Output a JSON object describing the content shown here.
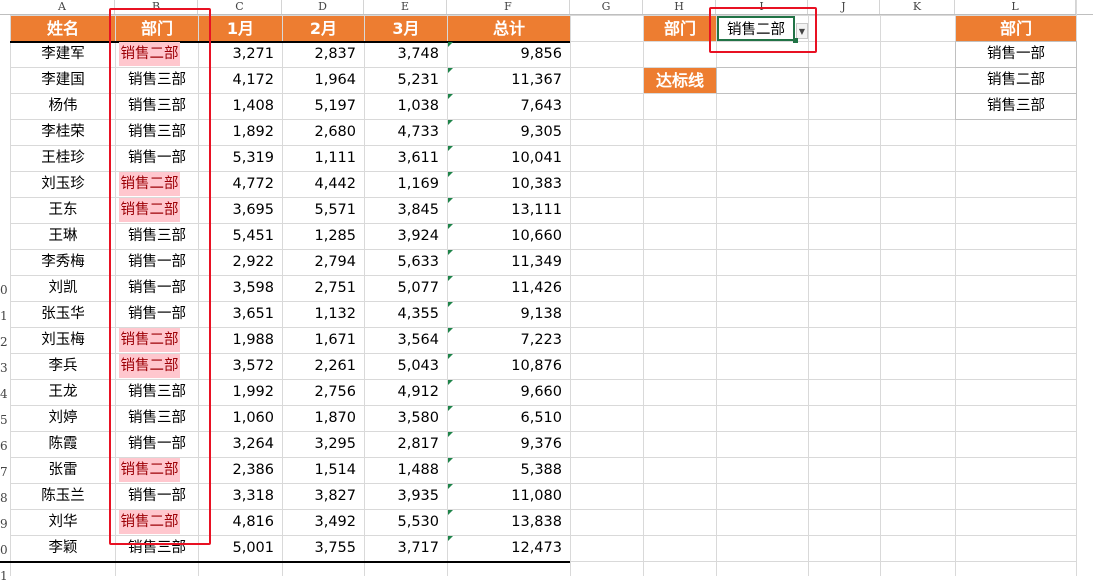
{
  "columns": [
    "A",
    "B",
    "C",
    "D",
    "E",
    "F",
    "G",
    "H",
    "I",
    "J",
    "K",
    "L"
  ],
  "row_labels": [
    "0",
    "1",
    "2",
    "3",
    "4",
    "5",
    "6",
    "7",
    "8",
    "9",
    "0",
    "1"
  ],
  "table": {
    "headers": [
      "姓名",
      "部门",
      "1月",
      "2月",
      "3月",
      "总计"
    ],
    "rows": [
      [
        "李建军",
        "销售二部",
        "3,271",
        "2,837",
        "3,748",
        "9,856"
      ],
      [
        "李建国",
        "销售三部",
        "4,172",
        "1,964",
        "5,231",
        "11,367"
      ],
      [
        "杨伟",
        "销售三部",
        "1,408",
        "5,197",
        "1,038",
        "7,643"
      ],
      [
        "李桂荣",
        "销售三部",
        "1,892",
        "2,680",
        "4,733",
        "9,305"
      ],
      [
        "王桂珍",
        "销售一部",
        "5,319",
        "1,111",
        "3,611",
        "10,041"
      ],
      [
        "刘玉珍",
        "销售二部",
        "4,772",
        "4,442",
        "1,169",
        "10,383"
      ],
      [
        "王东",
        "销售二部",
        "3,695",
        "5,571",
        "3,845",
        "13,111"
      ],
      [
        "王琳",
        "销售三部",
        "5,451",
        "1,285",
        "3,924",
        "10,660"
      ],
      [
        "李秀梅",
        "销售一部",
        "2,922",
        "2,794",
        "5,633",
        "11,349"
      ],
      [
        "刘凯",
        "销售一部",
        "3,598",
        "2,751",
        "5,077",
        "11,426"
      ],
      [
        "张玉华",
        "销售一部",
        "3,651",
        "1,132",
        "4,355",
        "9,138"
      ],
      [
        "刘玉梅",
        "销售二部",
        "1,988",
        "1,671",
        "3,564",
        "7,223"
      ],
      [
        "李兵",
        "销售二部",
        "3,572",
        "2,261",
        "5,043",
        "10,876"
      ],
      [
        "王龙",
        "销售三部",
        "1,992",
        "2,756",
        "4,912",
        "9,660"
      ],
      [
        "刘婷",
        "销售三部",
        "1,060",
        "1,870",
        "3,580",
        "6,510"
      ],
      [
        "陈霞",
        "销售一部",
        "3,264",
        "3,295",
        "2,817",
        "9,376"
      ],
      [
        "张雷",
        "销售二部",
        "2,386",
        "1,514",
        "1,488",
        "5,388"
      ],
      [
        "陈玉兰",
        "销售一部",
        "3,318",
        "3,827",
        "3,935",
        "11,080"
      ],
      [
        "刘华",
        "销售二部",
        "4,816",
        "3,492",
        "5,530",
        "13,838"
      ],
      [
        "李颖",
        "销售三部",
        "5,001",
        "3,755",
        "3,717",
        "12,473"
      ]
    ],
    "highlight_value": "销售二部"
  },
  "criteria": {
    "dept_label": "部门",
    "dept_value": "销售二部",
    "threshold_label": "达标线",
    "threshold_value": ""
  },
  "dept_list": {
    "header": "部门",
    "items": [
      "销售一部",
      "销售二部",
      "销售三部"
    ]
  },
  "colors": {
    "header_bg": "#ed7d31",
    "header_text": "#ffffff",
    "highlight_bg": "#ffc7ce",
    "highlight_text": "#9c0006",
    "annotation_red": "#e81123",
    "gridline": "#d9d9d9"
  },
  "icons": {
    "dropdown": "dropdown-arrow-icon",
    "error_marker": "green-triangle-icon"
  }
}
